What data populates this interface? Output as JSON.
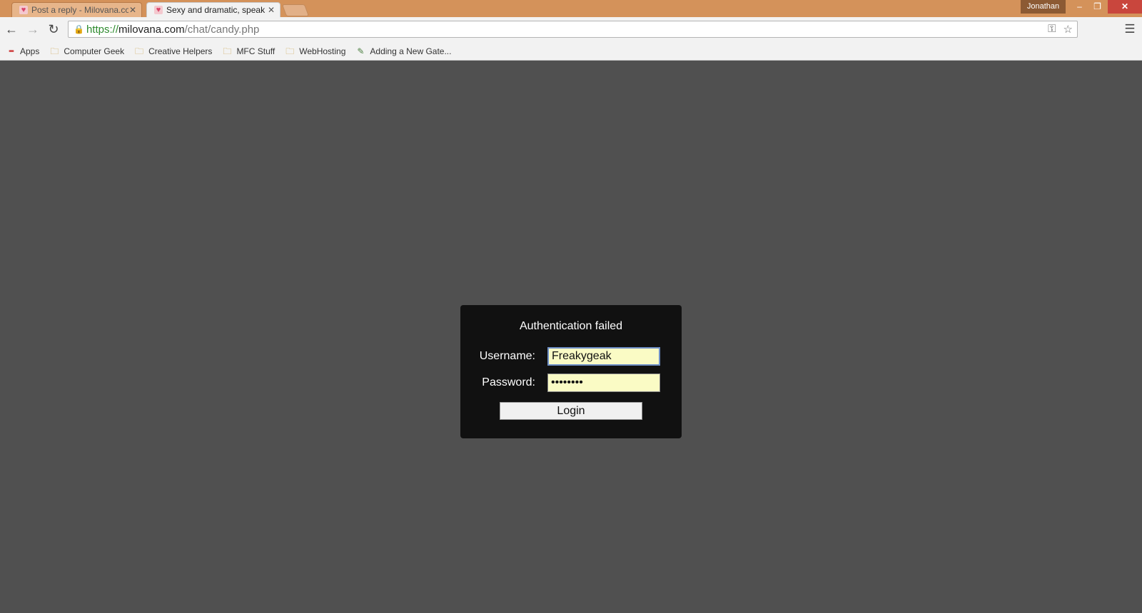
{
  "tabs": [
    {
      "title": "Post a reply - Milovana.co",
      "active": false
    },
    {
      "title": "Sexy and dramatic, speak",
      "active": true
    }
  ],
  "profile_name": "Jonathan",
  "window_controls": {
    "minimize": "–",
    "restore": "❐",
    "close": "✕"
  },
  "address": {
    "scheme": "https://",
    "host": "milovana.com",
    "path": "/chat/candy.php"
  },
  "bookmarks": [
    {
      "label": "Apps",
      "icon": "apps-grid-icon"
    },
    {
      "label": "Computer Geek",
      "icon": "folder-icon"
    },
    {
      "label": "Creative Helpers",
      "icon": "folder-icon"
    },
    {
      "label": "MFC Stuff",
      "icon": "folder-icon"
    },
    {
      "label": "WebHosting",
      "icon": "folder-icon"
    },
    {
      "label": "Adding a New Gate...",
      "icon": "page-icon"
    }
  ],
  "dialog": {
    "title": "Authentication failed",
    "username_label": "Username:",
    "username_value": "Freakygeak",
    "password_label": "Password:",
    "password_value": "••••••••",
    "login_label": "Login"
  },
  "colors": {
    "page_bg": "#505050",
    "dialog_bg": "#111111",
    "input_bg": "#fafbc5",
    "titlebar": "#d4925a"
  }
}
